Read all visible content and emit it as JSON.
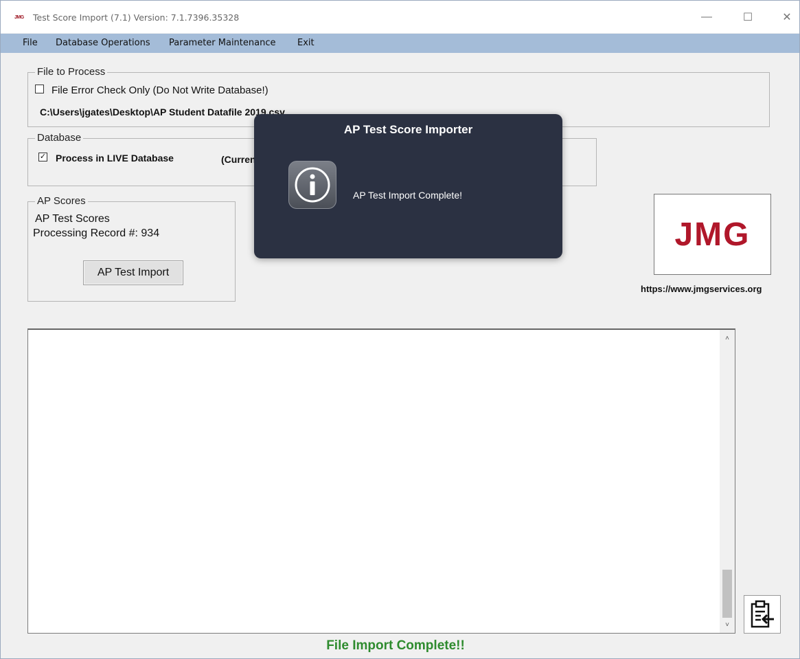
{
  "window": {
    "app_icon_text": "JMG",
    "title": "Test Score Import (7.1) Version: 7.1.7396.35328",
    "minimize_glyph": "—",
    "maximize_glyph": "☐",
    "close_glyph": "✕"
  },
  "menu": {
    "items": [
      {
        "label": "File"
      },
      {
        "label": "Database Operations"
      },
      {
        "label": "Parameter Maintenance"
      },
      {
        "label": "Exit"
      }
    ]
  },
  "file_group": {
    "legend": "File to Process",
    "error_check_label": "File Error Check Only (Do Not Write Database!)",
    "error_check_checked": false,
    "file_path": "C:\\Users\\jgates\\Desktop\\AP Student Datafile 2019.csv"
  },
  "database_group": {
    "legend": "Database",
    "live_label": "Process in LIVE Database",
    "live_checked": true,
    "current_text": "(Current"
  },
  "ap_group": {
    "legend": "AP Scores",
    "line1": "AP Test Scores",
    "line2": "Processing Record #: 934",
    "import_button": "AP Test Import"
  },
  "logo": {
    "text": "JMG",
    "url": "https://www.jmgservices.org",
    "color": "#b0172a"
  },
  "log": {
    "scroll_up": "˄",
    "scroll_down": "˅"
  },
  "status": {
    "text": "File Import Complete!!",
    "color": "#2e8b2e"
  },
  "dialog": {
    "title": "AP Test Score Importer",
    "message": "AP Test Import Complete!",
    "icon": "info-icon"
  }
}
